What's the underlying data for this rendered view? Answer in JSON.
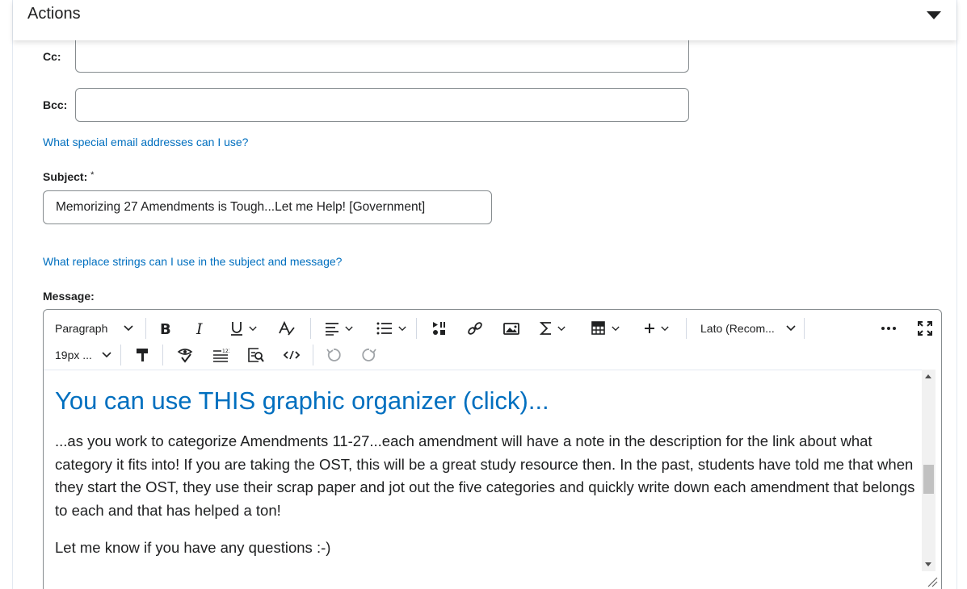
{
  "actions": {
    "title": "Actions",
    "toggle_icon": "caret-down-icon"
  },
  "cc": {
    "label": "Cc:",
    "value": ""
  },
  "bcc": {
    "label": "Bcc:",
    "value": ""
  },
  "links": {
    "special_emails": "What special email addresses can I use?",
    "replace_strings": "What replace strings can I use in the subject and message?"
  },
  "subject": {
    "label": "Subject:",
    "required_marker": "*",
    "value": "Memorizing 27 Amendments is Tough...Let me Help! [Government]"
  },
  "message": {
    "label": "Message:"
  },
  "toolbar": {
    "paragraph_format": "Paragraph",
    "font_family": "Lato (Recom...",
    "font_size": "19px ...",
    "icons": [
      "bold-icon",
      "italic-icon",
      "underline-icon",
      "text-color-icon",
      "align-icon",
      "list-icon",
      "media-icon",
      "link-icon",
      "image-icon",
      "equation-icon",
      "table-icon",
      "insert-icon",
      "more-icon",
      "fullscreen-icon",
      "format-painter-icon",
      "accessibility-checker-icon",
      "line-spacing-icon",
      "preview-icon",
      "source-code-icon",
      "undo-icon",
      "redo-icon"
    ]
  },
  "content": {
    "heading": "You can use THIS graphic organizer (click)...",
    "paragraph1": "...as you work to categorize Amendments 11-27...each amendment will have a note in the description for the link about what category it fits into! If you are taking the OST, this will be a great study resource then. In the past, students have told me that when they start the OST, they use their scrap paper and jot out the five categories and quickly write down each amendment that belongs to each and that has helped a ton!",
    "paragraph2": "Let me know if you have any questions :-)"
  },
  "colors": {
    "link": "#006fbf",
    "heading": "#006fbf",
    "text": "#202122",
    "border": "#868c8f"
  }
}
